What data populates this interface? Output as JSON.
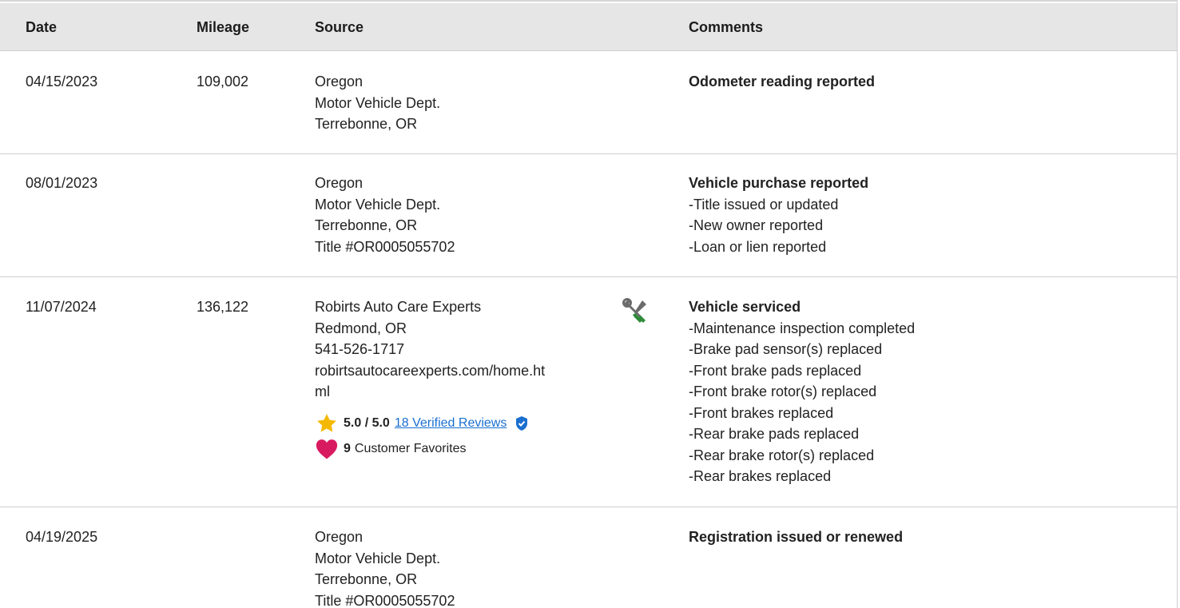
{
  "header": {
    "date": "Date",
    "mileage": "Mileage",
    "source": "Source",
    "comments": "Comments"
  },
  "rows": [
    {
      "date": "04/15/2023",
      "mileage": "109,002",
      "source": [
        "Oregon",
        "Motor Vehicle Dept.",
        "Terrebonne, OR"
      ],
      "comment_title": "Odometer reading reported",
      "comment_items": []
    },
    {
      "date": "08/01/2023",
      "mileage": "",
      "source": [
        "Oregon",
        "Motor Vehicle Dept.",
        "Terrebonne, OR",
        "Title #OR0005055702"
      ],
      "comment_title": "Vehicle purchase reported",
      "comment_items": [
        "Title issued or updated",
        "New owner reported",
        "Loan or lien reported"
      ]
    },
    {
      "date": "11/07/2024",
      "mileage": "136,122",
      "source": [
        "Robirts Auto Care Experts",
        "Redmond, OR",
        "541-526-1717",
        "robirtsautocareexperts.com/home.ht",
        "ml"
      ],
      "rating": "5.0 / 5.0",
      "reviews_link": "18 Verified Reviews",
      "favorites_count": "9",
      "favorites_label": "Customer Favorites",
      "icon": "wrench-screwdriver-icon",
      "comment_title": "Vehicle serviced",
      "comment_items": [
        "Maintenance inspection completed",
        "Brake pad sensor(s) replaced",
        "Front brake pads replaced",
        "Front brake rotor(s) replaced",
        "Front brakes replaced",
        "Rear brake pads replaced",
        "Rear brake rotor(s) replaced",
        "Rear brakes replaced"
      ]
    },
    {
      "date": "04/19/2025",
      "mileage": "",
      "source": [
        "Oregon",
        "Motor Vehicle Dept.",
        "Terrebonne, OR",
        "Title #OR0005055702"
      ],
      "comment_title": "Registration issued or renewed",
      "comment_items": []
    }
  ],
  "colors": {
    "header_bg": "#e6e6e6",
    "link": "#1a6fd0",
    "star": "#f5b800",
    "heart": "#d81b60",
    "verified": "#1a6fd0",
    "wrench_gray": "#6b6b6b",
    "screwdriver_green": "#2e8b3a"
  }
}
